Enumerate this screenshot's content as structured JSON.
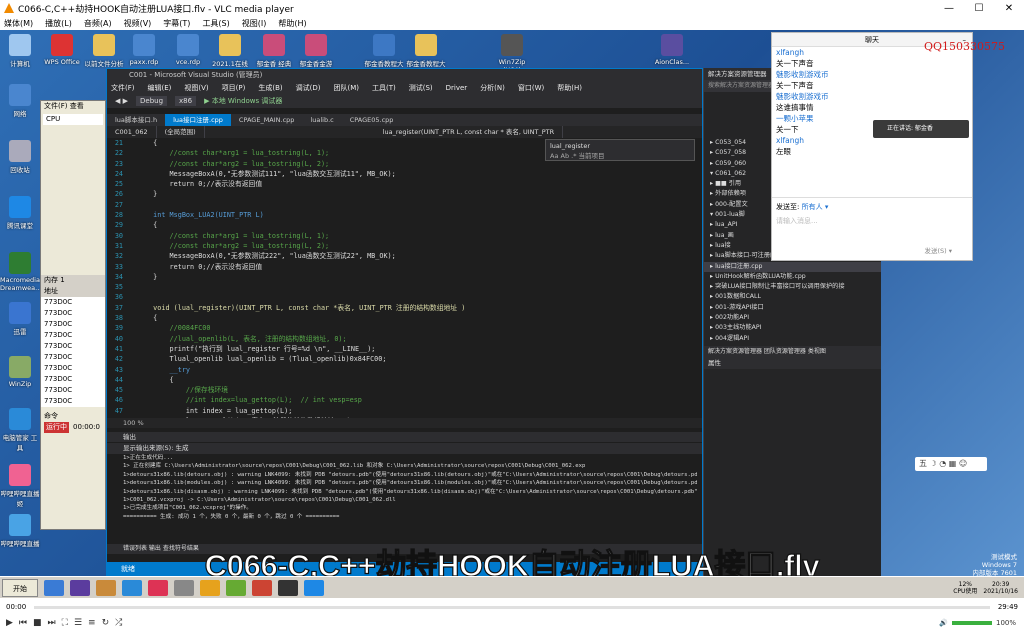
{
  "window": {
    "title": "C066-C,C++劫持HOOK自动注册LUA接口.flv - VLC media player",
    "controls": [
      "—",
      "☐",
      "✕"
    ]
  },
  "menu": [
    "媒体(M)",
    "播放(L)",
    "音频(A)",
    "视频(V)",
    "字幕(T)",
    "工具(S)",
    "视图(I)",
    "帮助(H)"
  ],
  "desktop_icons": [
    {
      "label": "计算机",
      "color": "#9fc7ef"
    },
    {
      "label": "WPS Office",
      "color": "#d33"
    },
    {
      "label": "以前文件分析",
      "color": "#e8c25a"
    },
    {
      "label": "paxx.rdp",
      "color": "#4a86cf"
    },
    {
      "label": "vce.rdp",
      "color": "#4a86cf"
    },
    {
      "label": "2021.1在线制",
      "color": "#e8c25a"
    },
    {
      "label": "郁金香 经典",
      "color": "#c94d7a"
    },
    {
      "label": "郁金香金游",
      "color": "#c94d7a"
    },
    {
      "label": "郁金香教程大",
      "color": "#3d78c4"
    },
    {
      "label": "郁金香教程大",
      "color": "#e8c25a"
    },
    {
      "label": "Win7Zip (X64)",
      "color": "#555"
    },
    {
      "label": "AionClas...",
      "color": "#5a4ea0"
    }
  ],
  "left_icons": [
    {
      "label": "网络",
      "color": "#4a86cf"
    },
    {
      "label": "回收站",
      "color": "#aab"
    },
    {
      "label": "腾讯课堂",
      "color": "#1e88e5"
    },
    {
      "label": "Macromedia Dreamwea...",
      "color": "#2e7d32"
    },
    {
      "label": "迅雷",
      "color": "#3a75d0"
    },
    {
      "label": "WinZip",
      "color": "#8a6"
    },
    {
      "label": "电脑管家 工具",
      "color": "#2a8ad8"
    },
    {
      "label": "哔哩哔哩直播姬",
      "color": "#f06292"
    },
    {
      "label": "哔哩哔哩直播",
      "color": "#49a3e5"
    },
    {
      "label": "VMware",
      "color": "#666"
    },
    {
      "label": "SoxAdd...",
      "color": "#aaa"
    }
  ],
  "leftwin": {
    "menu": "文件(F) 查看",
    "tab": "CPU",
    "rows": [
      "内存 1",
      "地址",
      "773D0C",
      "773D0C",
      "773D0C",
      "773D0C",
      "773D0C",
      "773D0C",
      "773D0C",
      "773D0C",
      "773D0C",
      "773D0C"
    ],
    "cmd": "命令",
    "status": "运行中",
    "time": "00:00:0"
  },
  "vs": {
    "title": "C001 - Microsoft Visual Studio (管理员)",
    "menu": [
      "文件(F)",
      "编辑(E)",
      "视图(V)",
      "项目(P)",
      "生成(B)",
      "调试(D)",
      "团队(M)",
      "工具(T)",
      "测试(S)",
      "Driver",
      "分析(N)",
      "窗口(W)",
      "帮助(H)"
    ],
    "toolbar": {
      "config": "Debug",
      "platform": "x86",
      "run": "▶ 本地 Windows 调试器"
    },
    "tabs": [
      "lua脚本接口.h",
      "lua接口注册.cpp",
      "CPAGE_MAIN.cpp",
      "lualib.c",
      "CPAGE05.cpp"
    ],
    "active_tab": 1,
    "nav": [
      "C001_062",
      "(全局范围)",
      "lua_register(UINT_PTR L, const char * 表名, UINT_PTR"
    ],
    "find": {
      "value": "lual_register",
      "option": "Aa  Ab  .*   当前项目"
    },
    "code": [
      {
        "n": "21",
        "t": "  {",
        "k": "tx"
      },
      {
        "n": "22",
        "t": "      //const char*arg1 = lua_tostring(L, 1);",
        "k": "c-cm"
      },
      {
        "n": "23",
        "t": "      //const char*arg2 = lua_tostring(L, 2);",
        "k": "c-cm"
      },
      {
        "n": "24",
        "t": "      MessageBoxA(0,\"无参数测试111\", \"lua函数交互测试11\", MB_OK);",
        "k": "tx"
      },
      {
        "n": "25",
        "t": "      return 0;//表示没有返回值",
        "k": "tx"
      },
      {
        "n": "26",
        "t": "  }",
        "k": "tx"
      },
      {
        "n": "27",
        "t": "",
        "k": "tx"
      },
      {
        "n": "28",
        "t": "  int MsgBox_LUA2(UINT_PTR L)",
        "k": "c-kw"
      },
      {
        "n": "29",
        "t": "  {",
        "k": "tx"
      },
      {
        "n": "30",
        "t": "      //const char*arg1 = lua_tostring(L, 1);",
        "k": "c-cm"
      },
      {
        "n": "31",
        "t": "      //const char*arg2 = lua_tostring(L, 2);",
        "k": "c-cm"
      },
      {
        "n": "32",
        "t": "      MessageBoxA(0,\"无参数测试222\", \"lua函数交互测试22\", MB_OK);",
        "k": "tx"
      },
      {
        "n": "33",
        "t": "      return 0;//表示没有返回值",
        "k": "tx"
      },
      {
        "n": "34",
        "t": "  }",
        "k": "tx"
      },
      {
        "n": "35",
        "t": "",
        "k": "tx"
      },
      {
        "n": "36",
        "t": "",
        "k": "tx"
      },
      {
        "n": "37",
        "t": "  void (lual_register)(UINT_PTR L, const char *表名, UINT_PTR 注册的结构数组地址 )",
        "k": "c-fn"
      },
      {
        "n": "38",
        "t": "  {",
        "k": "tx"
      },
      {
        "n": "39",
        "t": "      //0084FC00",
        "k": "c-cm"
      },
      {
        "n": "40",
        "t": "      //lual_openlib(L, 表名, 注册的结构数组地址, 0);",
        "k": "c-cm"
      },
      {
        "n": "41",
        "t": "      printf(\"执行到 lual_register 行号=%d \\n\", __LINE__);",
        "k": "tx"
      },
      {
        "n": "42",
        "t": "      Tlual_openlib lual_openlib = (Tlual_openlib)0x84FC00;",
        "k": "tx"
      },
      {
        "n": "43",
        "t": "      __try",
        "k": "c-kw"
      },
      {
        "n": "44",
        "t": "      {",
        "k": "tx"
      },
      {
        "n": "45",
        "t": "          //保存栈环境",
        "k": "c-cm"
      },
      {
        "n": "46",
        "t": "          //int index=lua_gettop(L);  // int vesp=esp",
        "k": "c-cm"
      },
      {
        "n": "47",
        "t": "          int index = lua_gettop(L);",
        "k": "tx"
      },
      {
        "n": "48",
        "t": "          luaI_openlib(L, 表名, 注册的结构数组地址, 0);",
        "k": "tx"
      },
      {
        "n": "49",
        "t": "          //恢复栈环境",
        "k": "c-cm"
      },
      {
        "n": "50",
        "t": "          //lua_settop(L, index);  // esp=vesp",
        "k": "c-cm"
      },
      {
        "n": "51",
        "t": "          lua_settop(L, index);",
        "k": "tx"
      },
      {
        "n": "52",
        "t": "      }",
        "k": "tx"
      },
      {
        "n": "53",
        "t": "      __except (1)",
        "k": "c-kw"
      }
    ],
    "zoom": "100 %",
    "output_title": "输出",
    "output_source": "显示输出来源(S): 生成",
    "output": [
      "1>正在生成代码...",
      "1>  正在创建库 C:\\Users\\Administrator\\source\\repos\\C001\\Debug\\C001_062.lib 和对象 C:\\Users\\Administrator\\source\\repos\\C001\\Debug\\C001_062.exp",
      "1>detours31x86.lib(detours.obj) : warning LNK4099: 未找到 PDB \"detours.pdb\"(使用\"detours31x86.lib(detours.obj)\"或在\"C:\\Users\\Administrator\\source\\repos\\C001\\Debug\\detours.pdb\"",
      "1>detours31x86.lib(modules.obj) : warning LNK4099: 未找到 PDB \"detours.pdb\"(使用\"detours31x86.lib(modules.obj)\"或在\"C:\\Users\\Administrator\\source\\repos\\C001\\Debug\\detours.pdb\"",
      "1>detours31x86.lib(disasm.obj) : warning LNK4099: 未找到 PDB \"detours.pdb\"(使用\"detours31x86.lib(disasm.obj)\"或在\"C:\\Users\\Administrator\\source\\repos\\C001\\Debug\\detours.pdb\"",
      "1>C001_062.vcxproj -> C:\\Users\\Administrator\\source\\repos\\C001\\Debug\\C001_062.dll",
      "1>已完成生成项目\"C001_062.vcxproj\"的操作。",
      "========== 生成: 成功 1 个，失败 0 个，最新 0 个，跳过 0 个 =========="
    ],
    "output_tabs": "错误列表  输出  查找符号结果",
    "status": "就绪"
  },
  "solution": {
    "title": "解决方案资源管理器",
    "search": "搜索解决方案资源管理器(Ctrl+;)",
    "items": [
      "▸ C053_054",
      "▸ C057_058",
      "▸ C059_060",
      "▾ C061_062",
      "  ▸ ■■ 引用",
      "  ▸ 外部依赖项",
      "  ▸ 000-配置文",
      "  ▾ 001-lua脚",
      "    ▸ lua_API",
      "    ▸ lua_画",
      "    ▸ lua接",
      "    ▸ lua脚本接口-可注册的).cpp",
      "    ▸ lua接口注册.cpp",
      "    ▸ UnitHook解析函数LUA功能.cpp",
      "    ▸ 突破LUA接口限制让丰富接口可以调用保护的接",
      "  ▸ 001数据和CALL",
      "  ▸ 001-游戏API接口",
      "  ▸ 002功能API",
      "  ▸ 003主线功能API",
      "  ▸ 004逻辑API"
    ],
    "tabs": "解决方案资源管理器  团队资源管理器  类视图",
    "props": "属性"
  },
  "chat": {
    "title": "聊天",
    "messages": [
      {
        "t": "xlfangh",
        "u": true
      },
      {
        "t": "关一下声音",
        "u": false
      },
      {
        "t": "魅影收割游戏币",
        "u": true
      },
      {
        "t": "关一下声音",
        "u": false
      },
      {
        "t": "魅影收割游戏币",
        "u": true
      },
      {
        "t": "这谁搞事情",
        "u": false
      },
      {
        "t": "一颗小苹果",
        "u": true
      },
      {
        "t": "关一下",
        "u": false
      },
      {
        "t": "xlfangh",
        "u": true
      },
      {
        "t": "左眼",
        "u": false
      }
    ],
    "send_to": "发送至:",
    "target": "所有人 ▾",
    "input_placeholder": "请输入消息...",
    "send": "发送(S) ▾",
    "speaking": "正在讲话: 郁金香QQ150330575;",
    "qq_watermark": "QQ150330575"
  },
  "ime": "五 ☽ ◔ ▦ ☺",
  "watermark": [
    "测试模式",
    "Windows 7",
    "内部版本 7601"
  ],
  "subtitle": "C066-C,C++劫持HOOK自动注册LUA接口.flv",
  "taskbar": {
    "start": "开始",
    "cpu": "12%",
    "cpu_label": "CPU使用",
    "clock": "20:39",
    "date": "2021/10/16"
  },
  "player": {
    "elapsed": "00:00",
    "total": "29:49",
    "progress": 0.0,
    "volume": "100%",
    "volume_level": 1.0
  },
  "colors": {
    "accent": "#f18a00",
    "vs_blue": "#007acc"
  }
}
